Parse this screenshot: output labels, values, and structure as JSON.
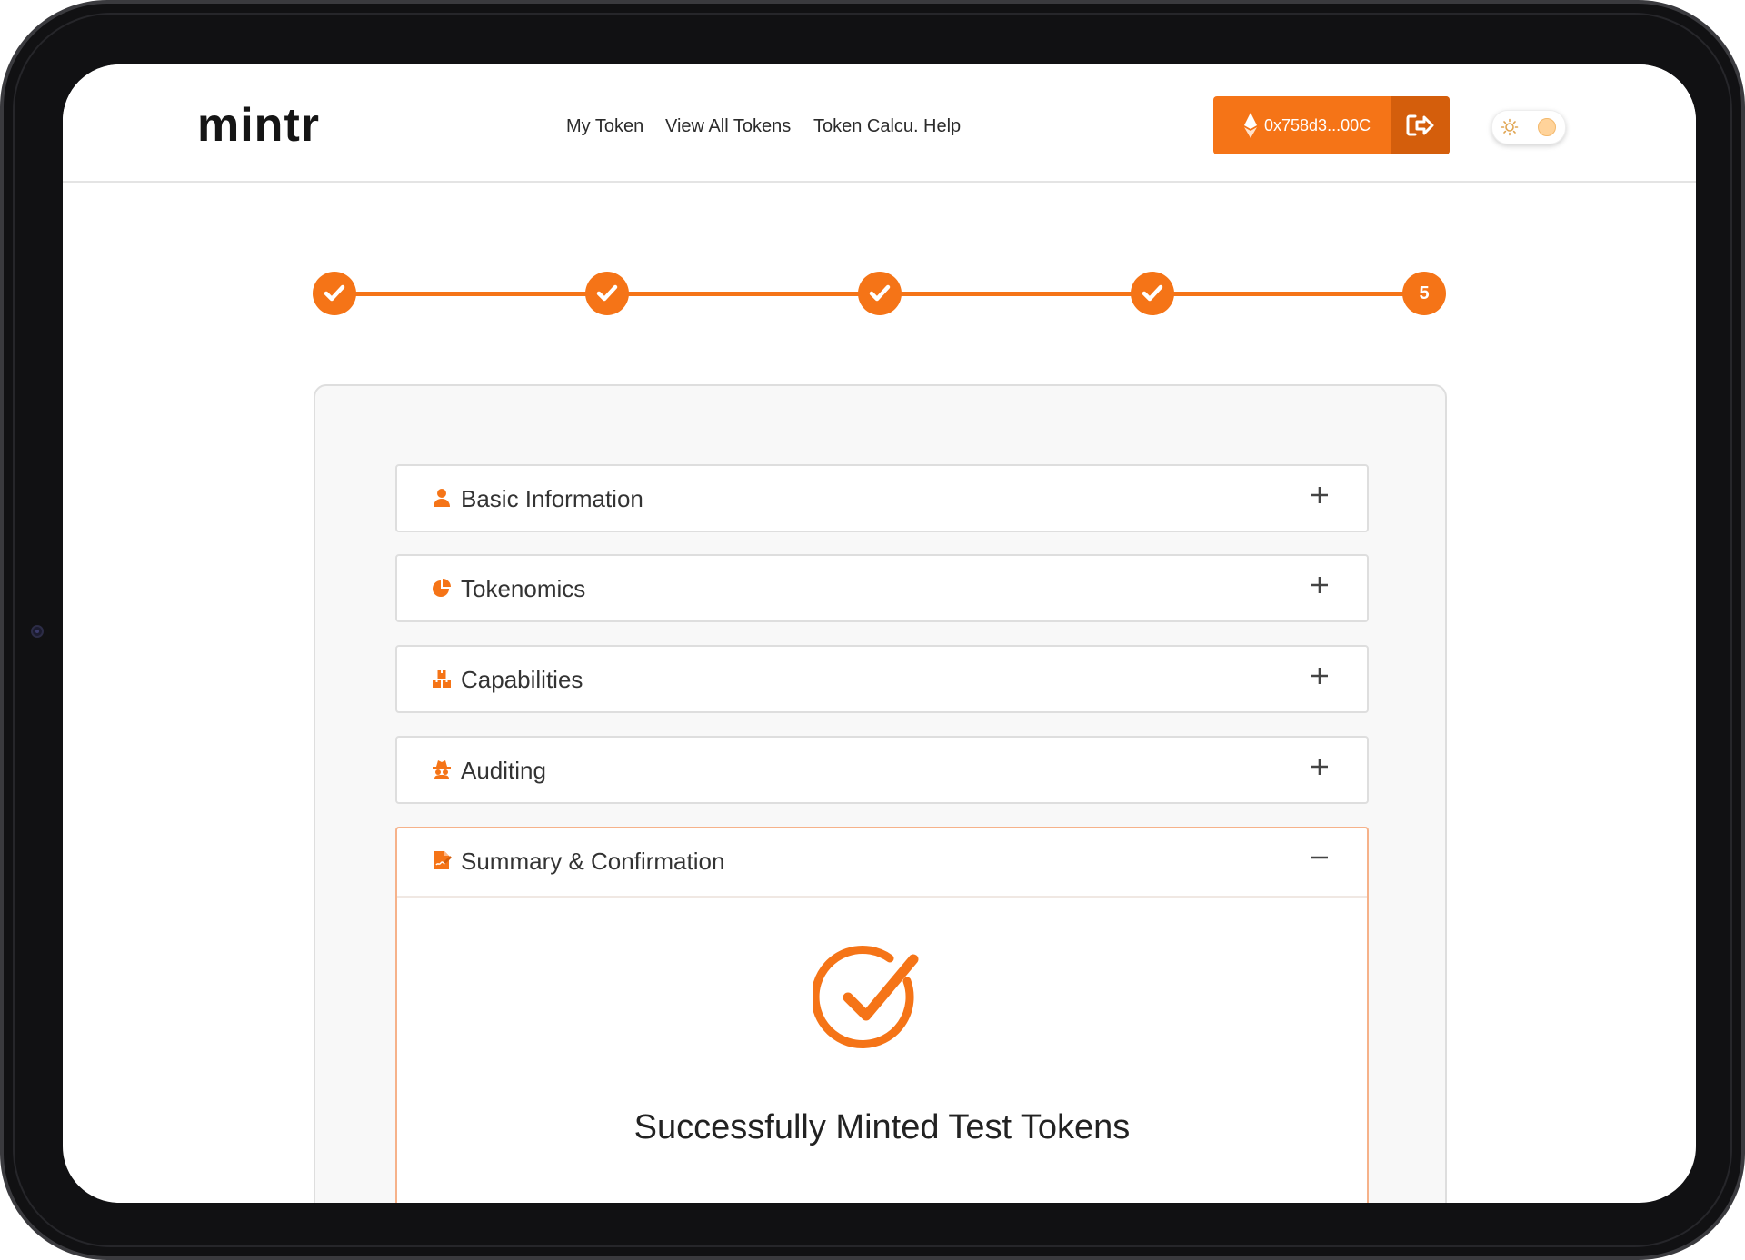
{
  "app": {
    "logo": "mintr"
  },
  "nav": {
    "items": [
      {
        "label": "My Token"
      },
      {
        "label": "View All Tokens"
      },
      {
        "label": "Token Calcu."
      },
      {
        "label": "Help"
      }
    ]
  },
  "wallet": {
    "address": "0x758d3...00C",
    "icon": "ethereum-icon",
    "action_icon": "logout-icon"
  },
  "theme_toggle": {
    "icon": "sun-icon",
    "state": "light"
  },
  "stepper": {
    "steps": [
      {
        "status": "complete"
      },
      {
        "status": "complete"
      },
      {
        "status": "complete"
      },
      {
        "status": "complete"
      },
      {
        "status": "current",
        "label": "5"
      }
    ]
  },
  "accordion": {
    "sections": [
      {
        "title": "Basic Information",
        "icon": "user-icon",
        "expanded": false
      },
      {
        "title": "Tokenomics",
        "icon": "pie-chart-icon",
        "expanded": false
      },
      {
        "title": "Capabilities",
        "icon": "boxes-icon",
        "expanded": false
      },
      {
        "title": "Auditing",
        "icon": "user-secret-icon",
        "expanded": false
      },
      {
        "title": "Summary & Confirmation",
        "icon": "file-signature-icon",
        "expanded": true
      }
    ]
  },
  "summary": {
    "message": "Successfully Minted Test Tokens",
    "icon": "check-circle-icon"
  },
  "colors": {
    "accent": "#f57417",
    "accent_dark": "#d45e0c",
    "text": "#333333",
    "border": "#dedede"
  }
}
